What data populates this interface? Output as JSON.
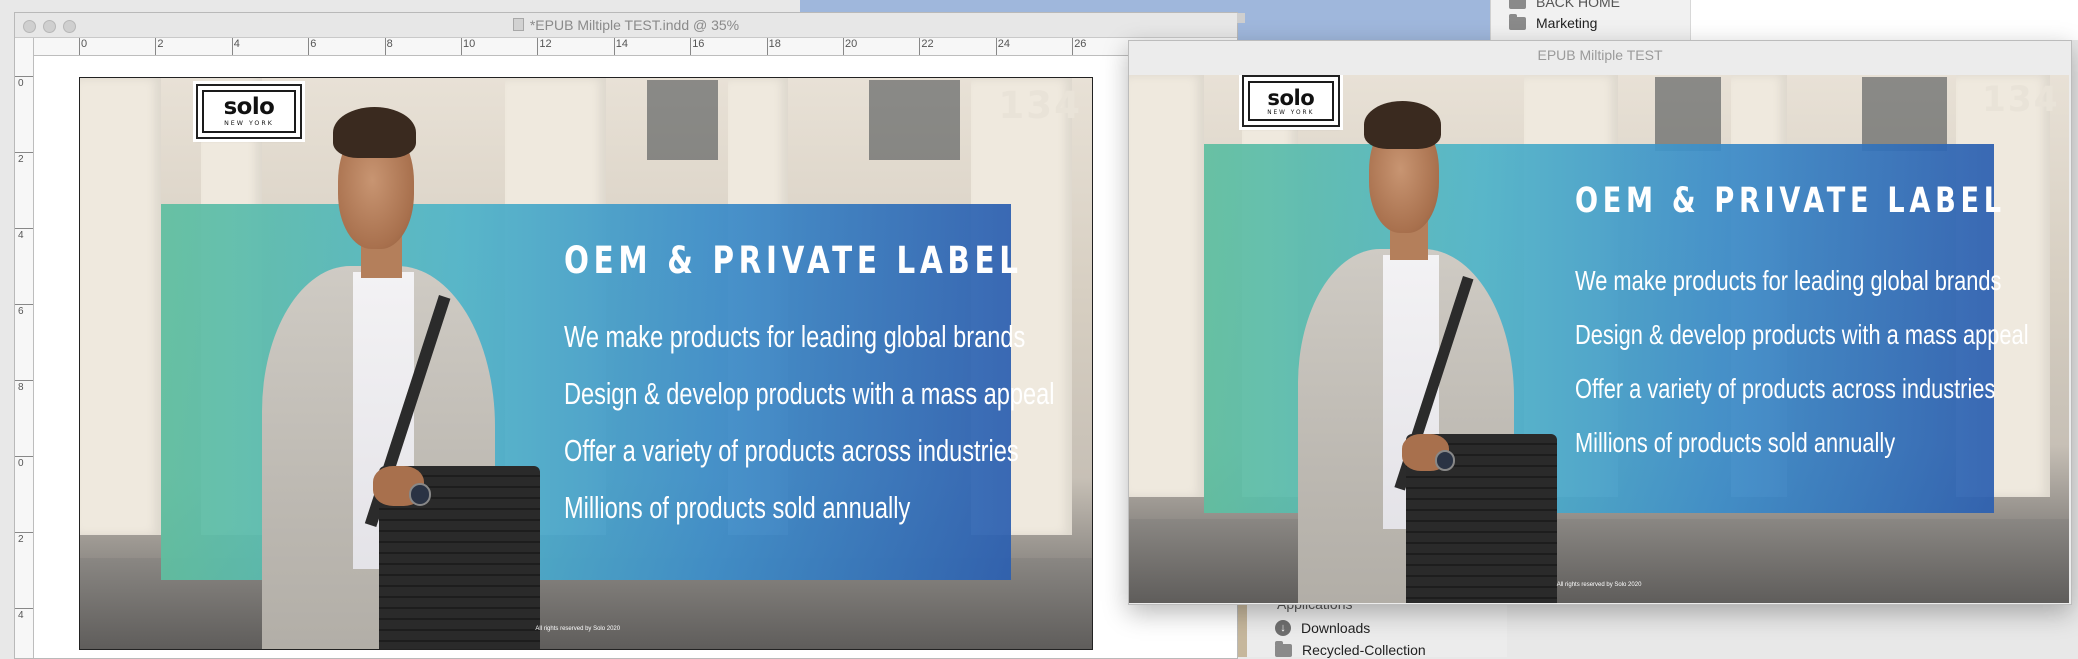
{
  "indesign": {
    "window_title": "*EPUB Miltiple TEST.indd @ 35%",
    "ruler_h": [
      "0",
      "2",
      "4",
      "6",
      "8",
      "10",
      "12",
      "14",
      "16",
      "18",
      "20",
      "22",
      "24",
      "26"
    ],
    "ruler_v": [
      "0",
      "2",
      "4",
      "6",
      "8",
      "0",
      "2",
      "4"
    ]
  },
  "epub_window": {
    "title": "EPUB Miltiple TEST"
  },
  "slide": {
    "logo_main": "solo",
    "logo_sub": "NEW YORK",
    "building_number": "134",
    "headline": "OEM & PRIVATE LABEL",
    "bullets": [
      "We make products for leading global brands",
      "Design & develop products with a mass appeal",
      "Offer a variety of products across industries",
      "Millions of products sold annually"
    ],
    "rights": "All rights reserved by Solo 2020"
  },
  "finder": {
    "top_partial": "BACK HOME",
    "marketing": "Marketing",
    "applications": "Applications",
    "downloads": "Downloads",
    "recycled": "Recycled-Collection"
  },
  "colors": {
    "panel_start": "#5fbfa0",
    "panel_end": "#2c5fb0"
  }
}
